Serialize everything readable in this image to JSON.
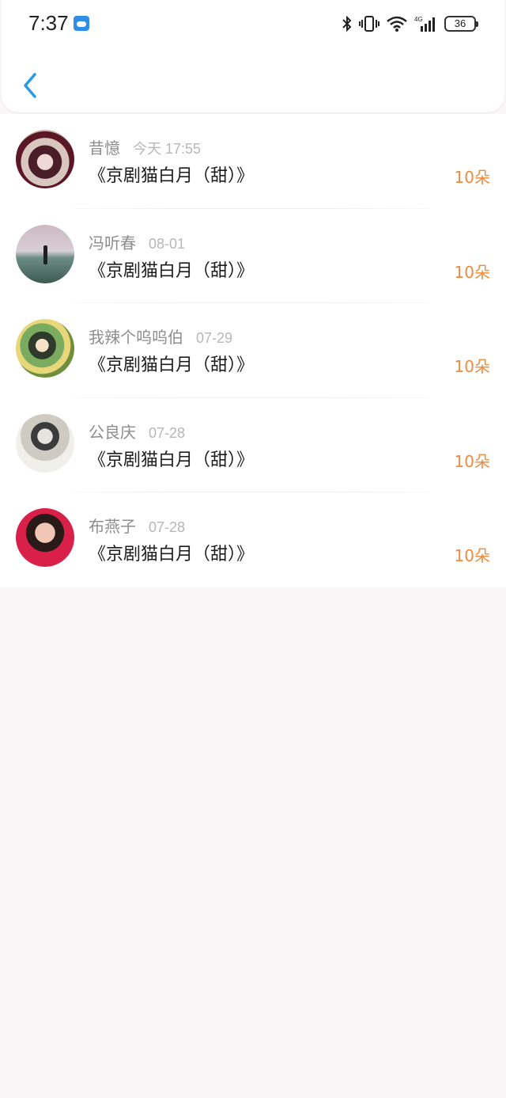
{
  "status_bar": {
    "time": "7:37",
    "battery": "36"
  },
  "list": [
    {
      "name": "昔憶",
      "date": "今天 17:55",
      "gift": "《京剧猫白月（甜）》",
      "count": "10朵"
    },
    {
      "name": "冯听春",
      "date": "08-01",
      "gift": "《京剧猫白月（甜）》",
      "count": "10朵"
    },
    {
      "name": "我辣个呜呜伯",
      "date": "07-29",
      "gift": "《京剧猫白月（甜）》",
      "count": "10朵"
    },
    {
      "name": "公良庆",
      "date": "07-28",
      "gift": "《京剧猫白月（甜）》",
      "count": "10朵"
    },
    {
      "name": "布燕子",
      "date": "07-28",
      "gift": "《京剧猫白月（甜）》",
      "count": "10朵"
    }
  ],
  "colors": {
    "accent": "#2a9ae6",
    "count": "#ef8a3b",
    "meta": "#b7b7b7"
  }
}
